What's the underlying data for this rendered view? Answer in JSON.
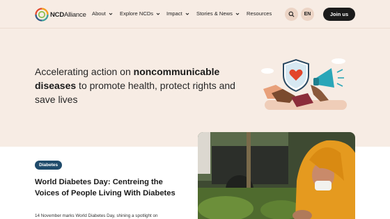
{
  "brand": {
    "logo_bold": "NCD",
    "logo_light": "Alliance"
  },
  "nav": {
    "items": [
      {
        "label": "About",
        "has_dropdown": true
      },
      {
        "label": "Explore NCDs",
        "has_dropdown": true
      },
      {
        "label": "Impact",
        "has_dropdown": true
      },
      {
        "label": "Stories & News",
        "has_dropdown": true
      },
      {
        "label": "Resources",
        "has_dropdown": false
      }
    ],
    "search_icon": "search-icon",
    "language": "EN",
    "join_label": "Join us"
  },
  "hero": {
    "text_part1": "Accelerating action on ",
    "text_bold": "noncommunicable diseases",
    "text_part2": " to promote health, protect rights and save lives"
  },
  "featured": {
    "badge": "Diabetes",
    "title": "World Diabetes Day: Centreing the Voices of People Living With Diabetes",
    "summary": "14 November marks World Diabetes Day, shining a spotlight on"
  },
  "colors": {
    "header_bg": "#f7ece4",
    "accent_pill": "#ecd4c5",
    "badge_bg": "#1f4b6b",
    "join_bg": "#1b1b1b"
  }
}
